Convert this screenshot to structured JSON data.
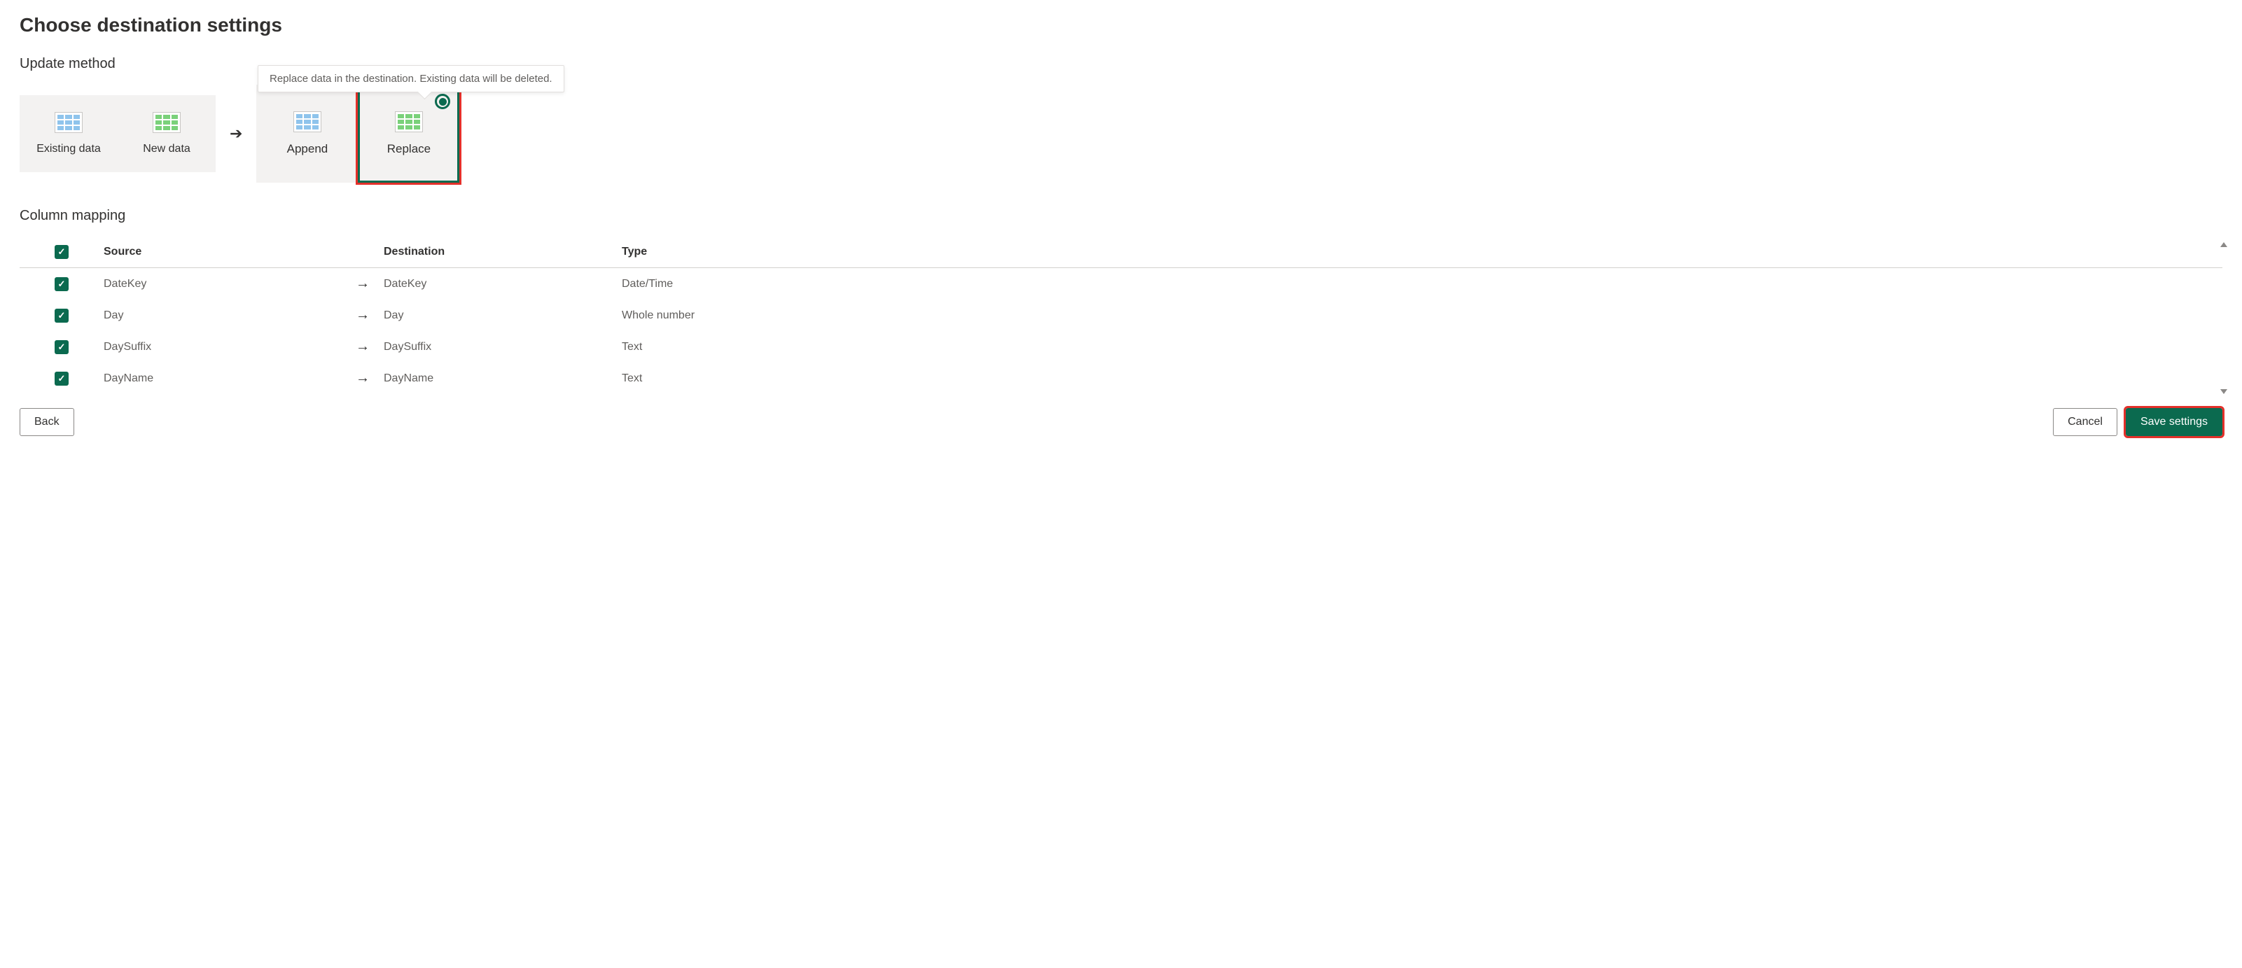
{
  "title": "Choose destination settings",
  "update_method": {
    "label": "Update method",
    "tooltip": "Replace data in the destination. Existing data will be deleted.",
    "existing_label": "Existing data",
    "new_label": "New data",
    "options": {
      "append": "Append",
      "replace": "Replace"
    }
  },
  "column_mapping": {
    "label": "Column mapping",
    "headers": {
      "source": "Source",
      "destination": "Destination",
      "type": "Type"
    },
    "rows": [
      {
        "source": "DateKey",
        "destination": "DateKey",
        "type": "Date/Time"
      },
      {
        "source": "Day",
        "destination": "Day",
        "type": "Whole number"
      },
      {
        "source": "DaySuffix",
        "destination": "DaySuffix",
        "type": "Text"
      },
      {
        "source": "DayName",
        "destination": "DayName",
        "type": "Text"
      }
    ]
  },
  "buttons": {
    "back": "Back",
    "cancel": "Cancel",
    "save": "Save settings"
  }
}
